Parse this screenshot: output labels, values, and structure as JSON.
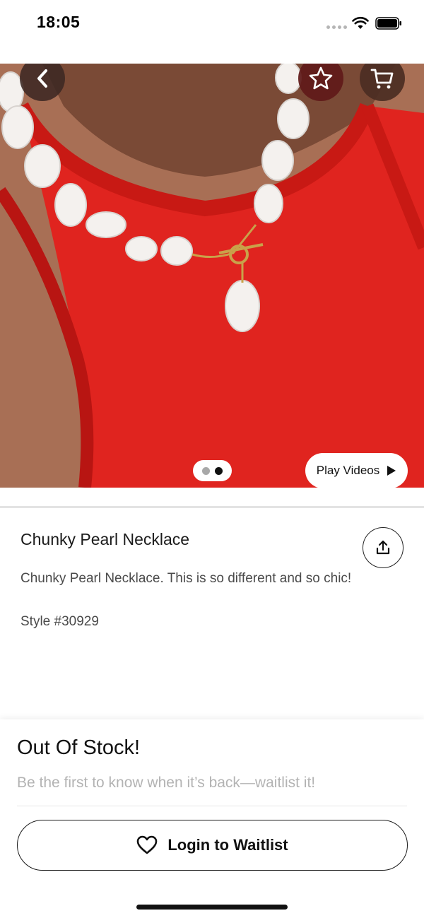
{
  "status_bar": {
    "time": "18:05",
    "icons": [
      "cellular-dots-icon",
      "wifi-icon",
      "battery-icon"
    ]
  },
  "hero": {
    "icons": {
      "back": "chevron-left-icon",
      "favorite": "star-icon",
      "cart": "cart-icon",
      "play": "play-icon"
    },
    "carousel": {
      "count": 2,
      "active_index": 1
    },
    "play_videos_label": "Play Videos"
  },
  "product": {
    "title": "Chunky Pearl Necklace",
    "description": "Chunky Pearl Necklace. This is so different and so chic!",
    "style": "Style #30929",
    "share_icon": "share-icon"
  },
  "stock": {
    "title": "Out Of Stock!",
    "subtitle": "Be the first to know when it’s back—waitlist it!",
    "button_label": "Login to Waitlist",
    "button_icon": "heart-icon"
  },
  "colors": {
    "accent": "#111111",
    "muted_text": "#b3b3b3",
    "hero_background": "#e0241f"
  }
}
